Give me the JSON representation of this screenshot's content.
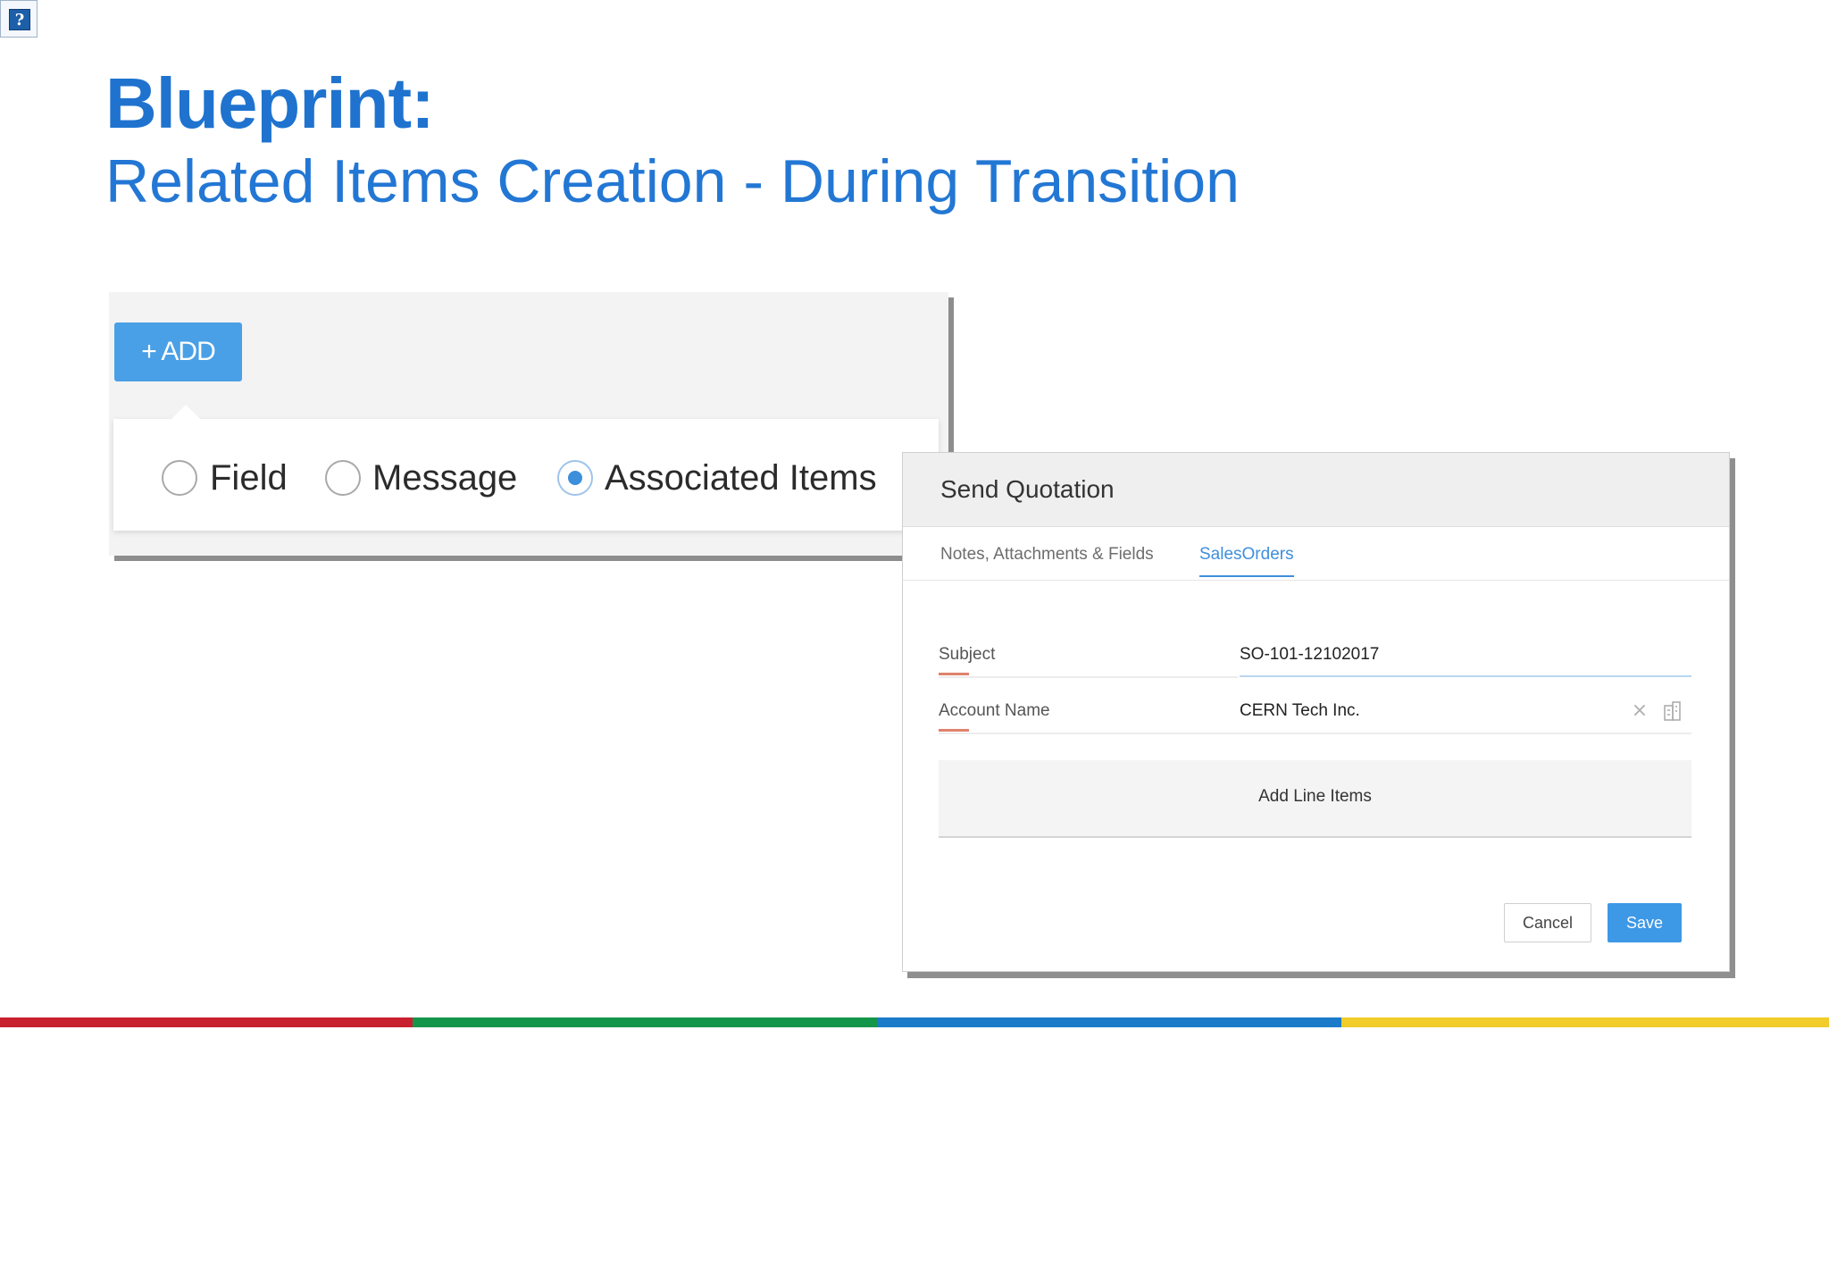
{
  "help_icon": {
    "icon": "help-icon",
    "glyph": "?"
  },
  "title": "Blueprint:",
  "subtitle": "Related Items Creation - During Transition",
  "add_panel": {
    "add_button_label": "+ ADD",
    "options": [
      {
        "label": "Field",
        "selected": false
      },
      {
        "label": "Message",
        "selected": false
      },
      {
        "label": "Associated Items",
        "selected": true
      }
    ]
  },
  "dialog": {
    "title": "Send Quotation",
    "tabs": [
      {
        "label": "Notes, Attachments & Fields",
        "active": false
      },
      {
        "label": "SalesOrders",
        "active": true
      }
    ],
    "fields": [
      {
        "label": "Subject",
        "value": "SO-101-12102017"
      },
      {
        "label": "Account Name",
        "value": "CERN Tech Inc."
      }
    ],
    "line_items_label": "Add Line Items",
    "cancel_label": "Cancel",
    "save_label": "Save"
  },
  "colors": {
    "accent": "#1f73cf",
    "button_blue": "#4aa0e6",
    "stripe": [
      "#c8202f",
      "#14964a",
      "#1a7bc9",
      "#f1cc2b"
    ]
  }
}
